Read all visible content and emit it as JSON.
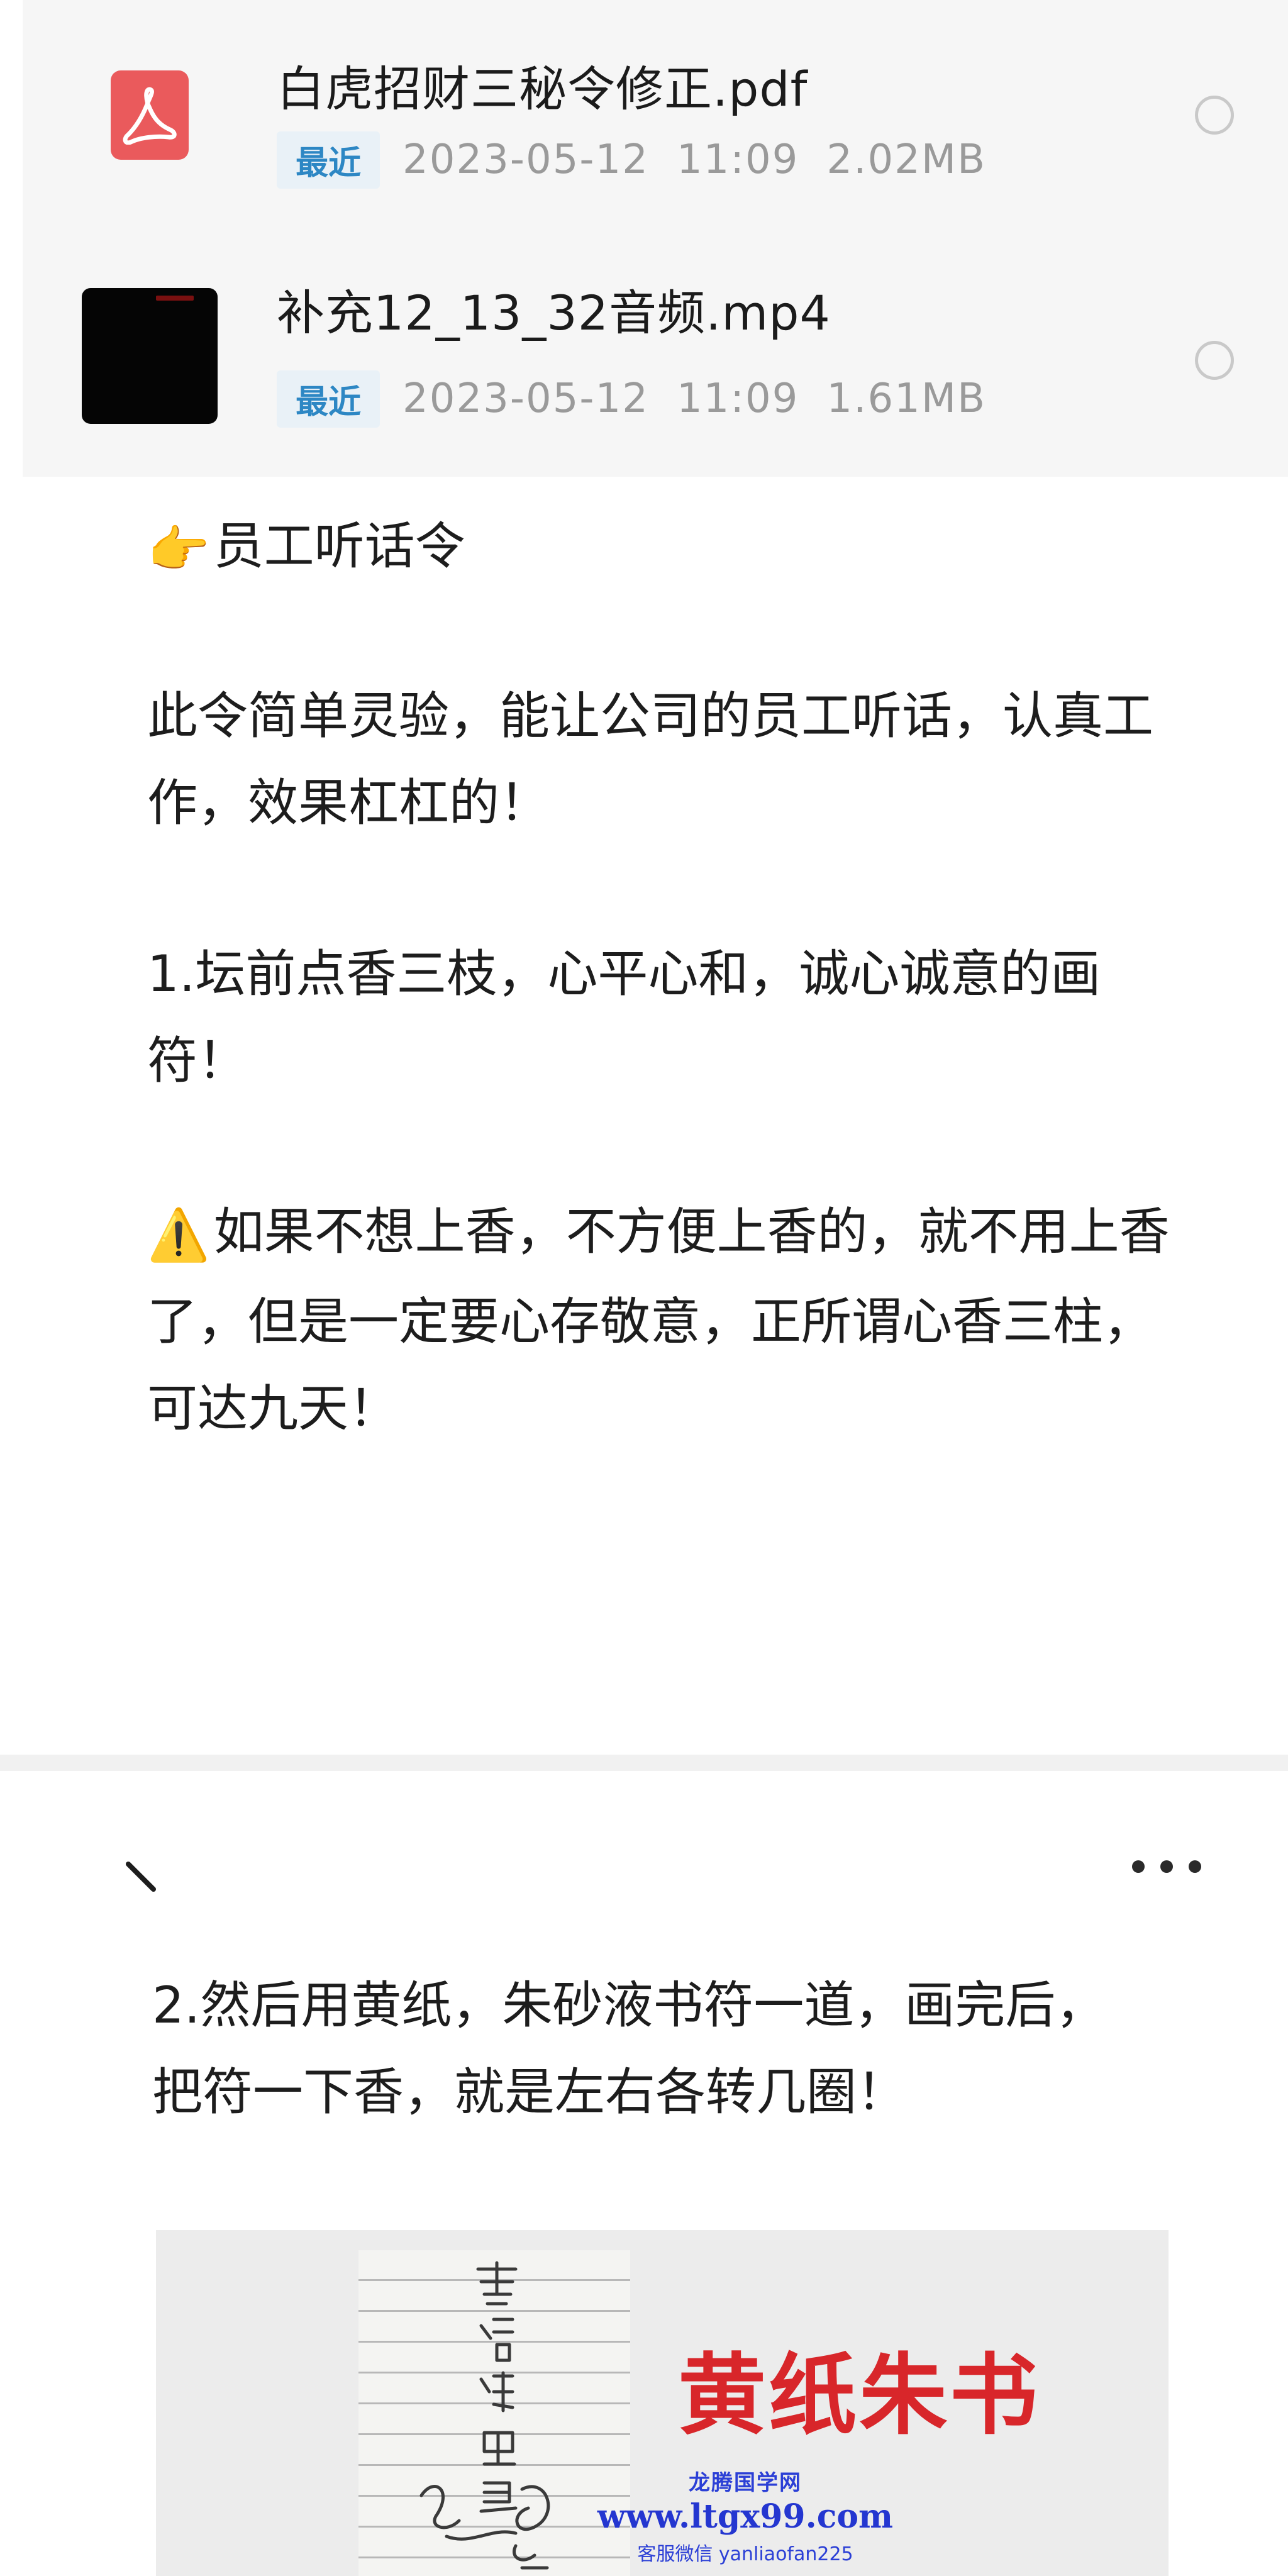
{
  "files": [
    {
      "name": "白虎招财三秘令修正.pdf",
      "badge": "最近",
      "date": "2023-05-12",
      "time": "11:09",
      "size": "2.02MB",
      "icon": "pdf-icon",
      "icon_color": "#ea5a5c"
    },
    {
      "name": "补充12_13_32音频.mp4",
      "badge": "最近",
      "date": "2023-05-12",
      "time": "11:09",
      "size": "1.61MB",
      "icon": "video-thumbnail",
      "icon_color": "#050505"
    }
  ],
  "article": {
    "heading_emoji": "👉",
    "heading": "员工听话令",
    "intro": "此令简单灵验，能让公司的员工听话，认真工作，效果杠杠的！",
    "step1": "1.坛前点香三枝，心平心和，诚心诚意的画符！",
    "warning_emoji": "⚠️",
    "warning": "如果不想上香，不方便上香的，就不用上香了，但是一定要心存敬意，正所谓心香三柱，可达九天！"
  },
  "second_screen": {
    "step2": "2.然后用黄纸，朱砂液书符一道，画完后，把符一下香，就是左右各转几圈！",
    "image_title": "黄纸朱书",
    "image_title_color": "#d8262a"
  },
  "watermark": {
    "name": "龙腾国学网",
    "url": "www.ltgx99.com",
    "contact": "客服微信 yanliaofan225",
    "color": "#2436d0"
  },
  "colors": {
    "badge_text": "#2d87c4",
    "badge_bg": "#e9f1f7",
    "meta_text": "#9a9a9a",
    "list_bg": "#f6f6f6"
  }
}
